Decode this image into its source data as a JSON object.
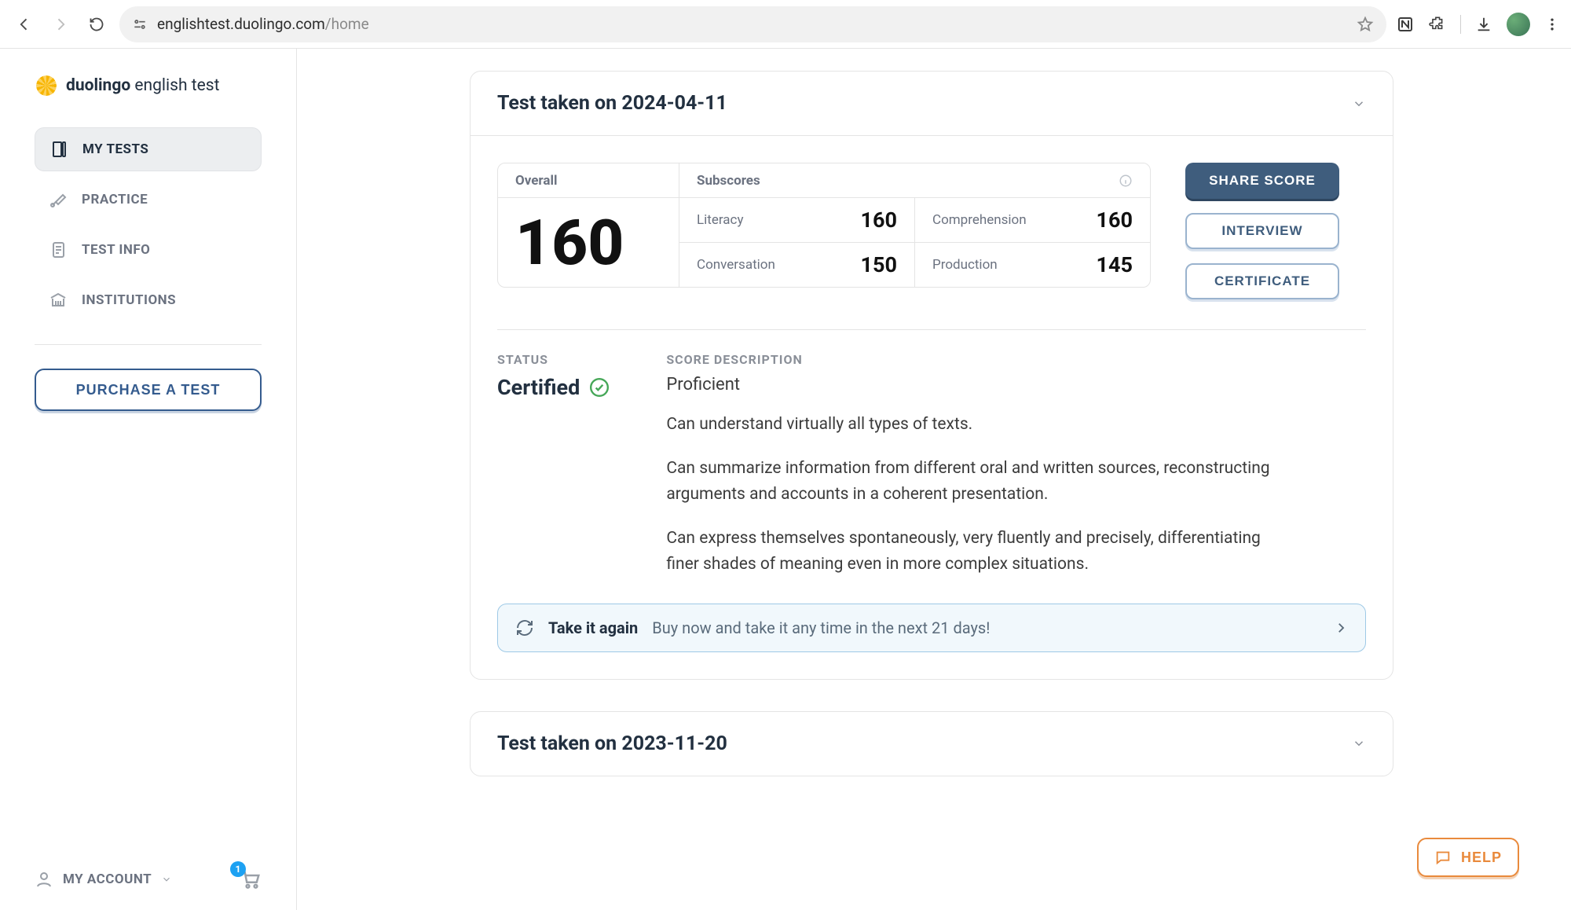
{
  "browser": {
    "url_host": "englishtest.duolingo.com",
    "url_path": "/home"
  },
  "brand": {
    "bold": "duolingo",
    "rest": " english test"
  },
  "sidebar": {
    "items": [
      {
        "label": "MY TESTS"
      },
      {
        "label": "PRACTICE"
      },
      {
        "label": "TEST INFO"
      },
      {
        "label": "INSTITUTIONS"
      }
    ],
    "purchase_label": "PURCHASE A TEST",
    "account_label": "MY ACCOUNT",
    "cart_count": "1"
  },
  "tests": [
    {
      "header": "Test taken on 2024-04-11",
      "overall_label": "Overall",
      "overall_score": "160",
      "subscores_label": "Subscores",
      "subscores": [
        {
          "label": "Literacy",
          "value": "160"
        },
        {
          "label": "Comprehension",
          "value": "160"
        },
        {
          "label": "Conversation",
          "value": "150"
        },
        {
          "label": "Production",
          "value": "145"
        }
      ],
      "actions": {
        "share": "SHARE SCORE",
        "interview": "INTERVIEW",
        "certificate": "CERTIFICATE"
      },
      "status_label": "STATUS",
      "status_value": "Certified",
      "desc_label": "SCORE DESCRIPTION",
      "desc_level": "Proficient",
      "desc_paras": [
        "Can understand virtually all types of texts.",
        "Can summarize information from different oral and written sources, reconstructing arguments and accounts in a coherent presentation.",
        "Can express themselves spontaneously, very fluently and precisely, differentiating finer shades of meaning even in more complex situations."
      ],
      "takeagain": {
        "title": "Take it again",
        "subtitle": "Buy now and take it any time in the next 21 days!"
      }
    },
    {
      "header": "Test taken on 2023-11-20"
    }
  ],
  "help_label": "HELP"
}
